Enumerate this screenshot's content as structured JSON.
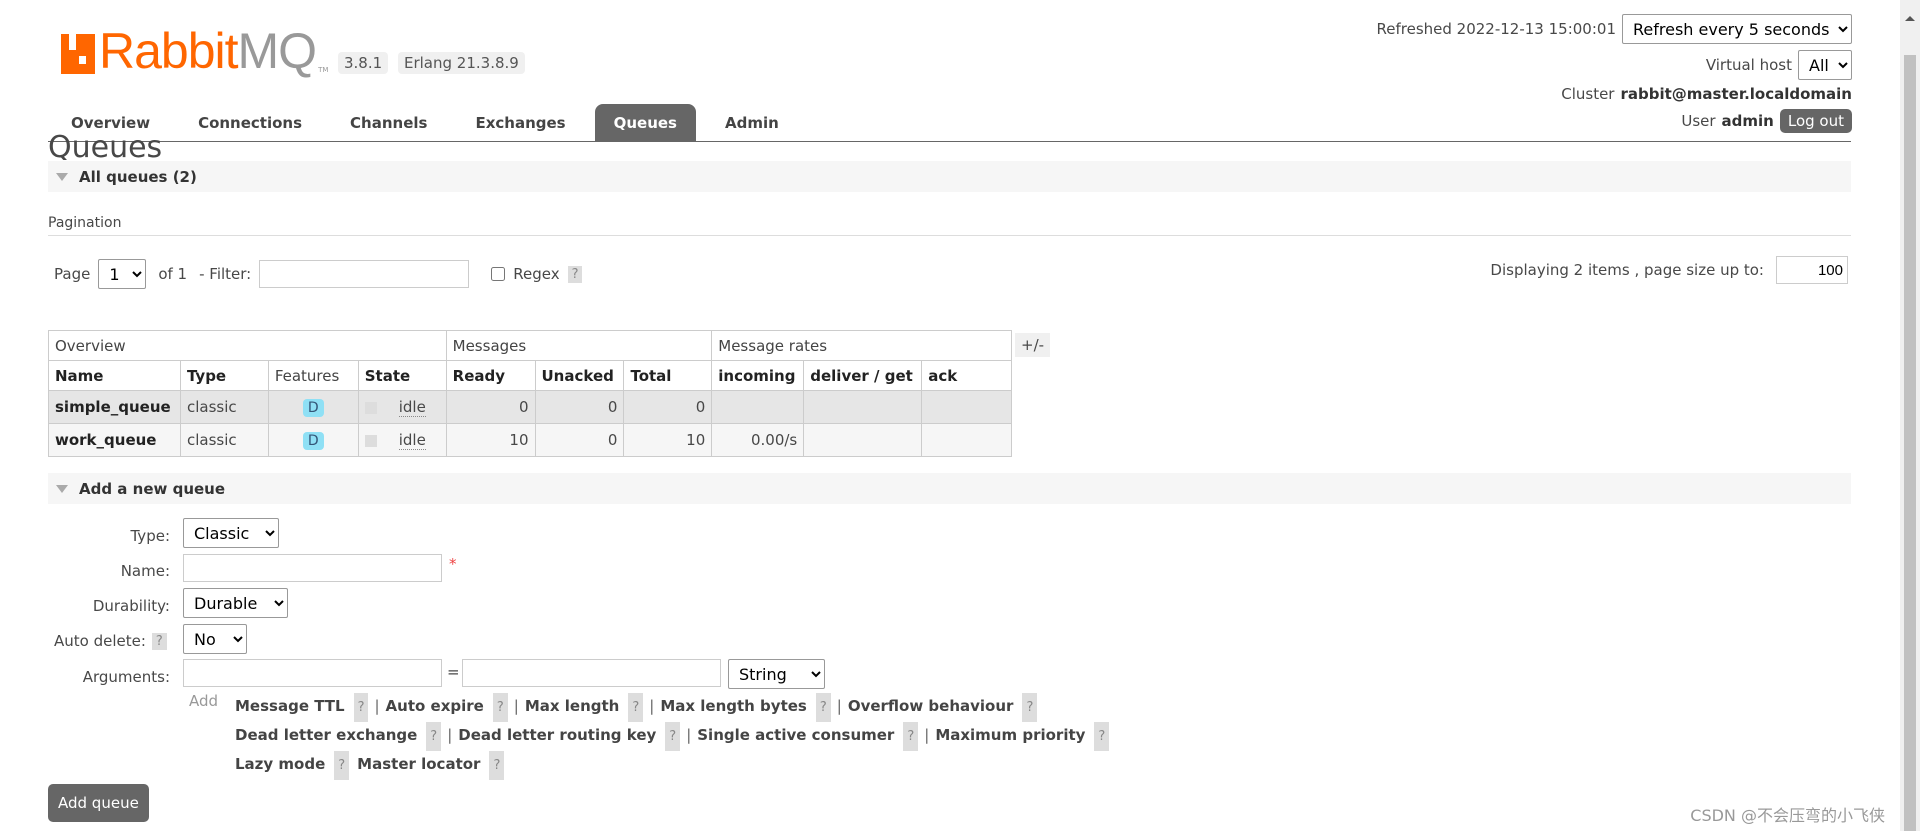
{
  "header": {
    "logo": "RabbitMQ",
    "version": "3.8.1",
    "erlang": "Erlang 21.3.8.9",
    "refreshed": "Refreshed 2022-12-13 15:00:01",
    "refresh_select": "Refresh every 5 seconds",
    "vhost_label": "Virtual host",
    "vhost_select": "All",
    "cluster_label": "Cluster",
    "cluster": "rabbit@master.localdomain",
    "user_label": "User",
    "user": "admin",
    "logout": "Log out"
  },
  "nav": [
    "Overview",
    "Connections",
    "Channels",
    "Exchanges",
    "Queues",
    "Admin"
  ],
  "page": {
    "title": "Queues",
    "all_queues": "All queues (2)",
    "pagination": "Pagination",
    "page_label": "Page",
    "page_value": "1",
    "of": "of 1",
    "filter_label": "- Filter:",
    "regex": "Regex",
    "help": "?",
    "displaying": "Displaying 2 items , page size up to:",
    "page_size": "100"
  },
  "table": {
    "groups": [
      "Overview",
      "Messages",
      "Message rates"
    ],
    "plusminus": "+/-",
    "columns": [
      "Name",
      "Type",
      "Features",
      "State",
      "Ready",
      "Unacked",
      "Total",
      "incoming",
      "deliver / get",
      "ack"
    ],
    "rows": [
      {
        "name": "simple_queue",
        "type": "classic",
        "feature": "D",
        "state": "idle",
        "ready": "0",
        "unacked": "0",
        "total": "0",
        "incoming": "",
        "deliver": "",
        "ack": ""
      },
      {
        "name": "work_queue",
        "type": "classic",
        "feature": "D",
        "state": "idle",
        "ready": "10",
        "unacked": "0",
        "total": "10",
        "incoming": "0.00/s",
        "deliver": "",
        "ack": ""
      }
    ]
  },
  "form": {
    "section": "Add a new queue",
    "type_label": "Type:",
    "type_value": "Classic",
    "name_label": "Name:",
    "required": "*",
    "durability_label": "Durability:",
    "durability_value": "Durable",
    "autodelete_label": "Auto delete:",
    "autodelete_value": "No",
    "arguments_label": "Arguments:",
    "eq": "=",
    "arg_type": "String",
    "add": "Add",
    "args": [
      [
        "Message TTL",
        "Auto expire",
        "Max length",
        "Max length bytes",
        "Overflow behaviour"
      ],
      [
        "Dead letter exchange",
        "Dead letter routing key",
        "Single active consumer",
        "Maximum priority"
      ],
      [
        "Lazy mode",
        "Master locator"
      ]
    ],
    "submit": "Add queue"
  },
  "watermark": "CSDN @不会压弯的小飞侠"
}
